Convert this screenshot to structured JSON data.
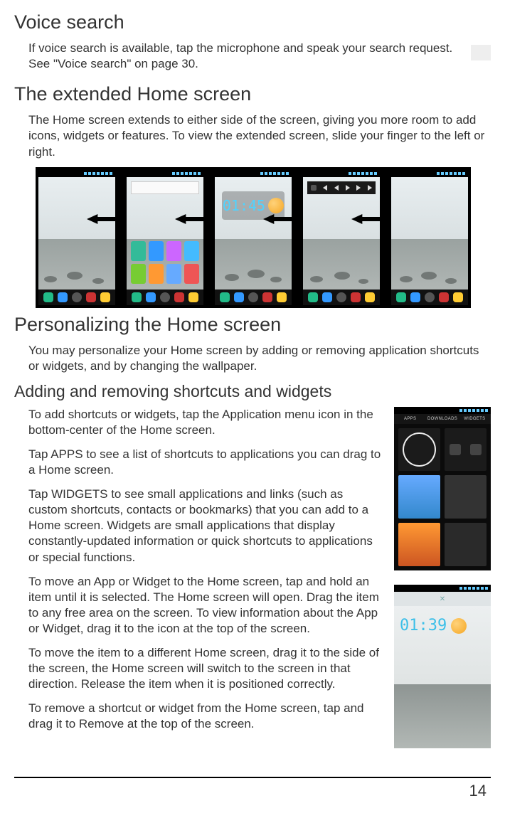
{
  "voice": {
    "heading": "Voice search",
    "body": "If voice search is available, tap the microphone and speak your search request. See \"Voice search\" on page 30."
  },
  "extended": {
    "heading": "The extended Home screen",
    "body": "The Home screen extends to either side of the screen, giving you more room to add icons, widgets or features. To view the extended screen, slide your finger to the left or right.",
    "clock_time": "01:45"
  },
  "personalize": {
    "heading": "Personalizing the Home screen",
    "body": "You may personalize your Home screen by adding or removing application shortcuts or widgets, and by changing the wallpaper."
  },
  "shortcuts": {
    "heading": "Adding and removing shortcuts and widgets",
    "p1_a": "To add shortcuts or widgets, tap the ",
    "p1_bold": "Application",
    "p1_b": " menu icon in the bottom-center of the Home screen.",
    "p2_a": "Tap ",
    "p2_bold": "APPS",
    "p2_b": " to see a list of shortcuts to applications you can drag to a Home screen.",
    "p3_a": "Tap ",
    "p3_bold": "WIDGETS",
    "p3_b": " to see small applications and links (such as custom shortcuts, contacts or bookmarks) that you can add to a Home screen. Widgets are small applications that display constantly-updated information or quick shortcuts to applications or special functions.",
    "p4": "To move an App or Widget to the Home screen, tap and hold an item until it is selected. The Home screen will open. Drag the item to any free area on the screen. To view information about the App or Widget, drag it to the icon at the top of the screen.",
    "p5": "To move the item to a different Home screen, drag it to the side of the screen, the Home screen will switch to the screen in that direction. Release the item when it is positioned correctly.",
    "p6_a": "To remove a shortcut or widget from the Home screen, tap and drag it to ",
    "p6_bold": "Remove",
    "p6_b": " at the top of the screen.",
    "side_tabs": {
      "a": "APPS",
      "b": "DOWNLOADS",
      "c": "WIDGETS"
    },
    "side_clock": "01:39"
  },
  "page_number": "14"
}
